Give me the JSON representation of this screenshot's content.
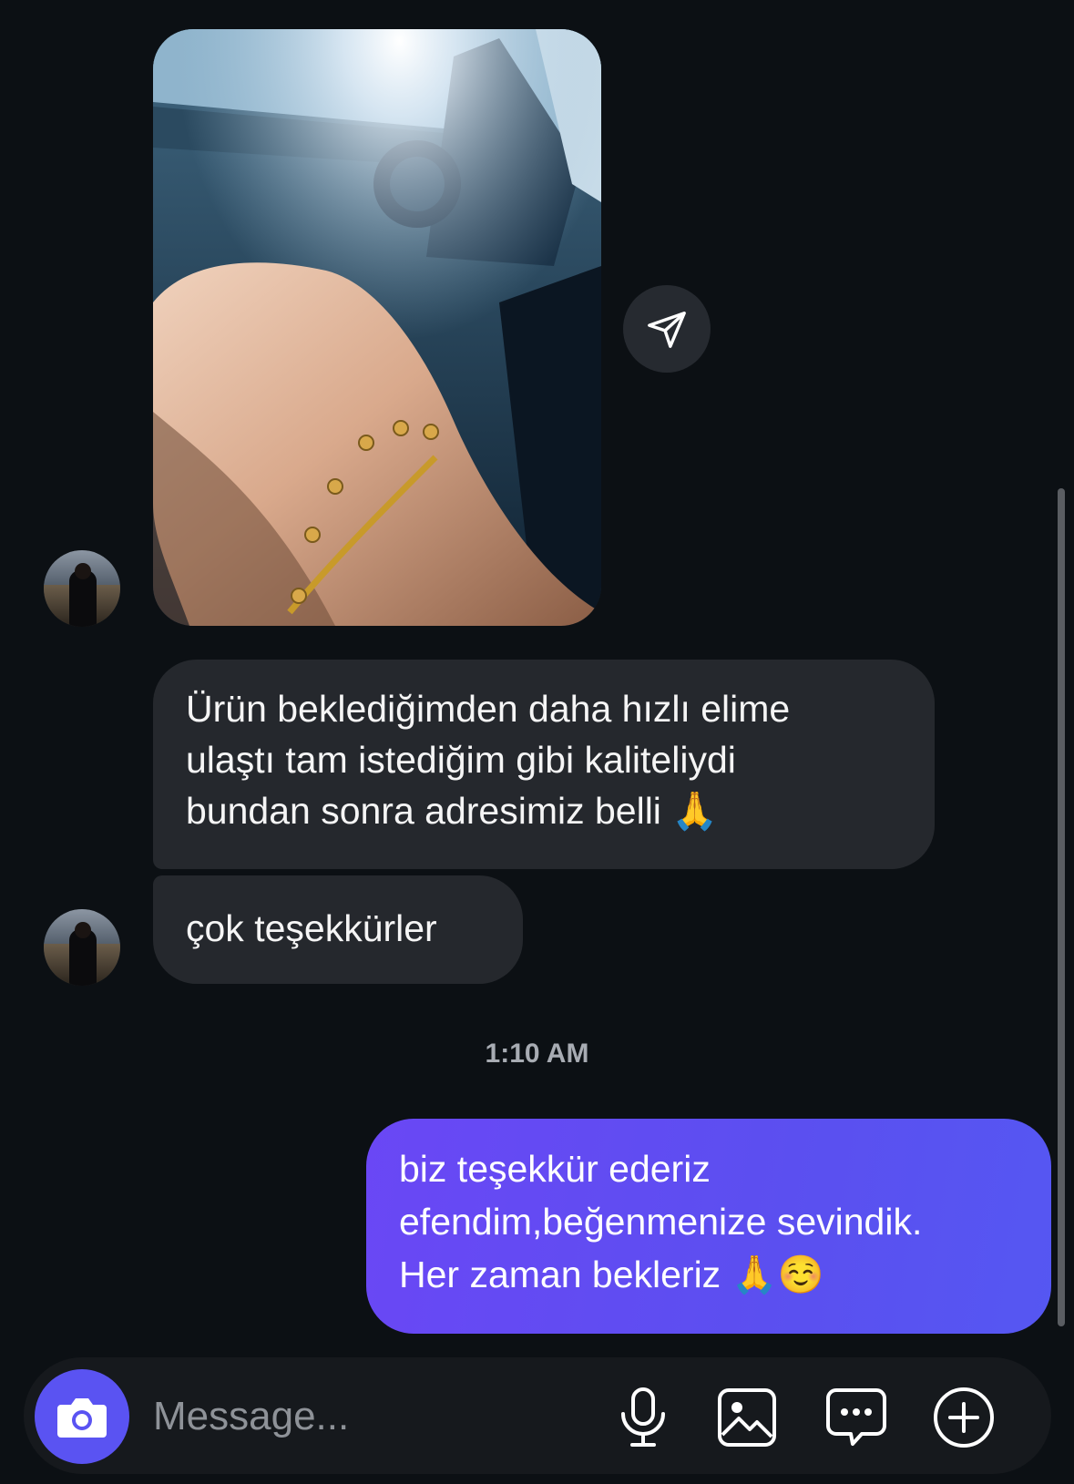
{
  "thread": {
    "incoming_messages": [
      "Ürün beklediğimden daha hızlı elime\nulaştı tam istediğim gibi kaliteliydi\nbundan sonra adresimiz belli 🙏",
      "çok teşekkürler"
    ],
    "timestamp": "1:10 AM",
    "outgoing_messages": [
      "biz teşekkür ederiz\nefendim,beğenmenize sevindik.\nHer zaman bekleriz 🙏☺️"
    ]
  },
  "composer": {
    "placeholder": "Message..."
  },
  "colors": {
    "background": "#0c1014",
    "incoming_bubble": "#25282d",
    "outgoing_bubble": "#5b4ff0",
    "accent": "#5a53f2"
  },
  "icons": [
    "avatar",
    "photo-attachment",
    "share-icon",
    "camera-icon",
    "microphone-icon",
    "gallery-icon",
    "sticker-icon",
    "plus-icon"
  ]
}
